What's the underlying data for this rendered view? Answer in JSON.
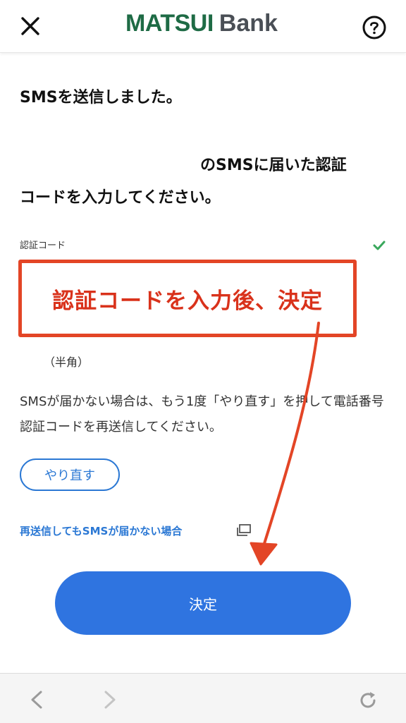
{
  "header": {
    "logo_brand": "MATSUI",
    "logo_bank": "Bank",
    "close_icon": "close-icon",
    "help_icon": "help-circle-icon"
  },
  "main": {
    "title": "SMSを送信しました。",
    "instruction_line1": "のSMSに届いた認証",
    "instruction_line2": "コードを入力してください。",
    "field_label": "認証コード",
    "field_annotation": "認証コードを入力後、決定",
    "field_note": "（半角）",
    "notice_text": "SMSが届かない場合は、もう1度「やり直す」を押して電話番号認証コードを再送信してください。",
    "retry_button": "やり直す",
    "help_link": "再送信してもSMSが届かない場合",
    "submit_button": "決定"
  },
  "colors": {
    "brand_green": "#1e6b45",
    "accent_blue": "#2f74e0",
    "link_blue": "#2b78d4",
    "annotation_red": "#e34526",
    "check_green": "#3aa85c"
  },
  "bottom_nav": {
    "back_icon": "chevron-left-icon",
    "forward_icon": "chevron-right-icon",
    "reload_icon": "reload-icon"
  }
}
